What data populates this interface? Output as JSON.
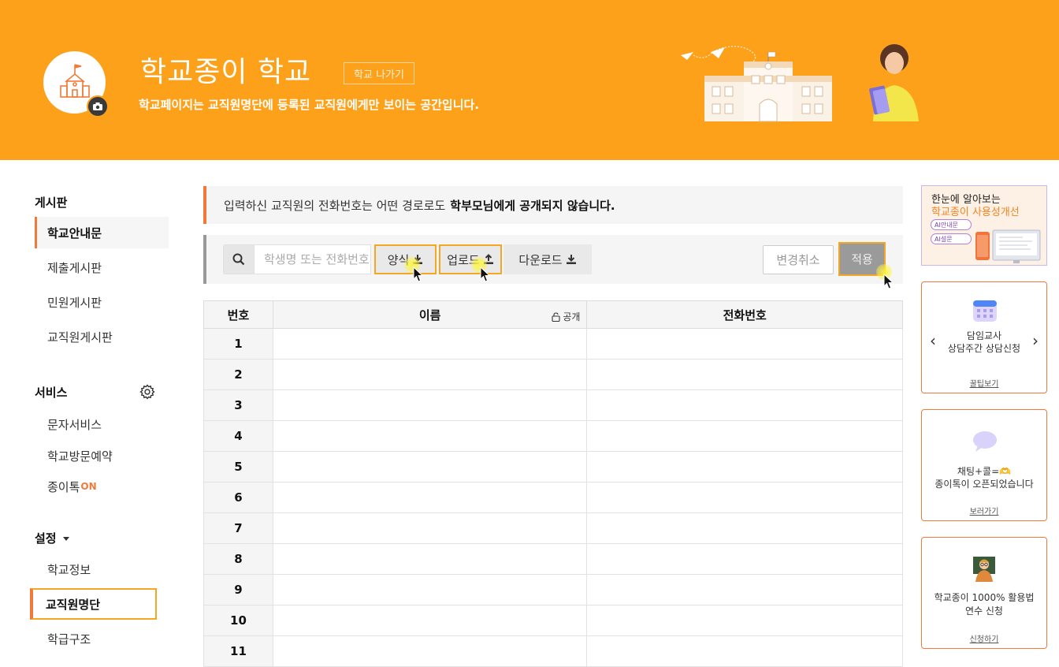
{
  "header": {
    "school_name": "학교종이 학교",
    "exit_button": "학교 나가기",
    "subtitle": "학교페이지는 교직원명단에 등록된 교직원에게만 보이는 공간입니다."
  },
  "sidebar": {
    "board_heading": "게시판",
    "board_items": [
      {
        "label": "학교안내문",
        "active": true
      },
      {
        "label": "제출게시판"
      },
      {
        "label": "민원게시판"
      },
      {
        "label": "교직원게시판"
      }
    ],
    "service_heading": "서비스",
    "service_items": [
      {
        "label": "문자서비스"
      },
      {
        "label": "학교방문예약"
      },
      {
        "label": "종이톡",
        "badge": "ON"
      }
    ],
    "settings_heading": "설정",
    "settings_items": [
      {
        "label": "학교정보"
      },
      {
        "label": "교직원명단",
        "selected": true
      },
      {
        "label": "학급구조"
      }
    ]
  },
  "notice": {
    "text": "입력하신 교직원의 전화번호는 어떤 경로로도",
    "bold": "학부모님에게 공개되지 않습니다."
  },
  "toolbar": {
    "search_placeholder": "학생명 또는 전화번호",
    "form_button": "양식",
    "upload_button": "업로드",
    "download_button": "다운로드",
    "cancel_button": "변경취소",
    "apply_button": "적용"
  },
  "table": {
    "headers": {
      "number": "번호",
      "name": "이름",
      "public": "공개",
      "phone": "전화번호"
    },
    "rows": [
      "1",
      "2",
      "3",
      "4",
      "5",
      "6",
      "7",
      "8",
      "9",
      "10",
      "11"
    ]
  },
  "right": {
    "banner_line1": "한눈에 알아보는",
    "banner_line2": "학교종이 사용성개선",
    "chip1": "AI안내문",
    "chip2": "AI설문",
    "card1": {
      "line1": "담임교사",
      "line2": "상담주간 상담신청",
      "link": "꿀팁보기"
    },
    "card2": {
      "line1": "채팅+콜=🫶",
      "line2": "종이톡이 오픈되었습니다",
      "link": "보러가기"
    },
    "card3": {
      "line1": "학교종이 1000% 활용법",
      "line2": "연수 신청",
      "link": "신청하기"
    }
  },
  "colors": {
    "brand_orange": "#fea11a",
    "accent": "#f07a3a",
    "highlight": "#f5a623"
  }
}
